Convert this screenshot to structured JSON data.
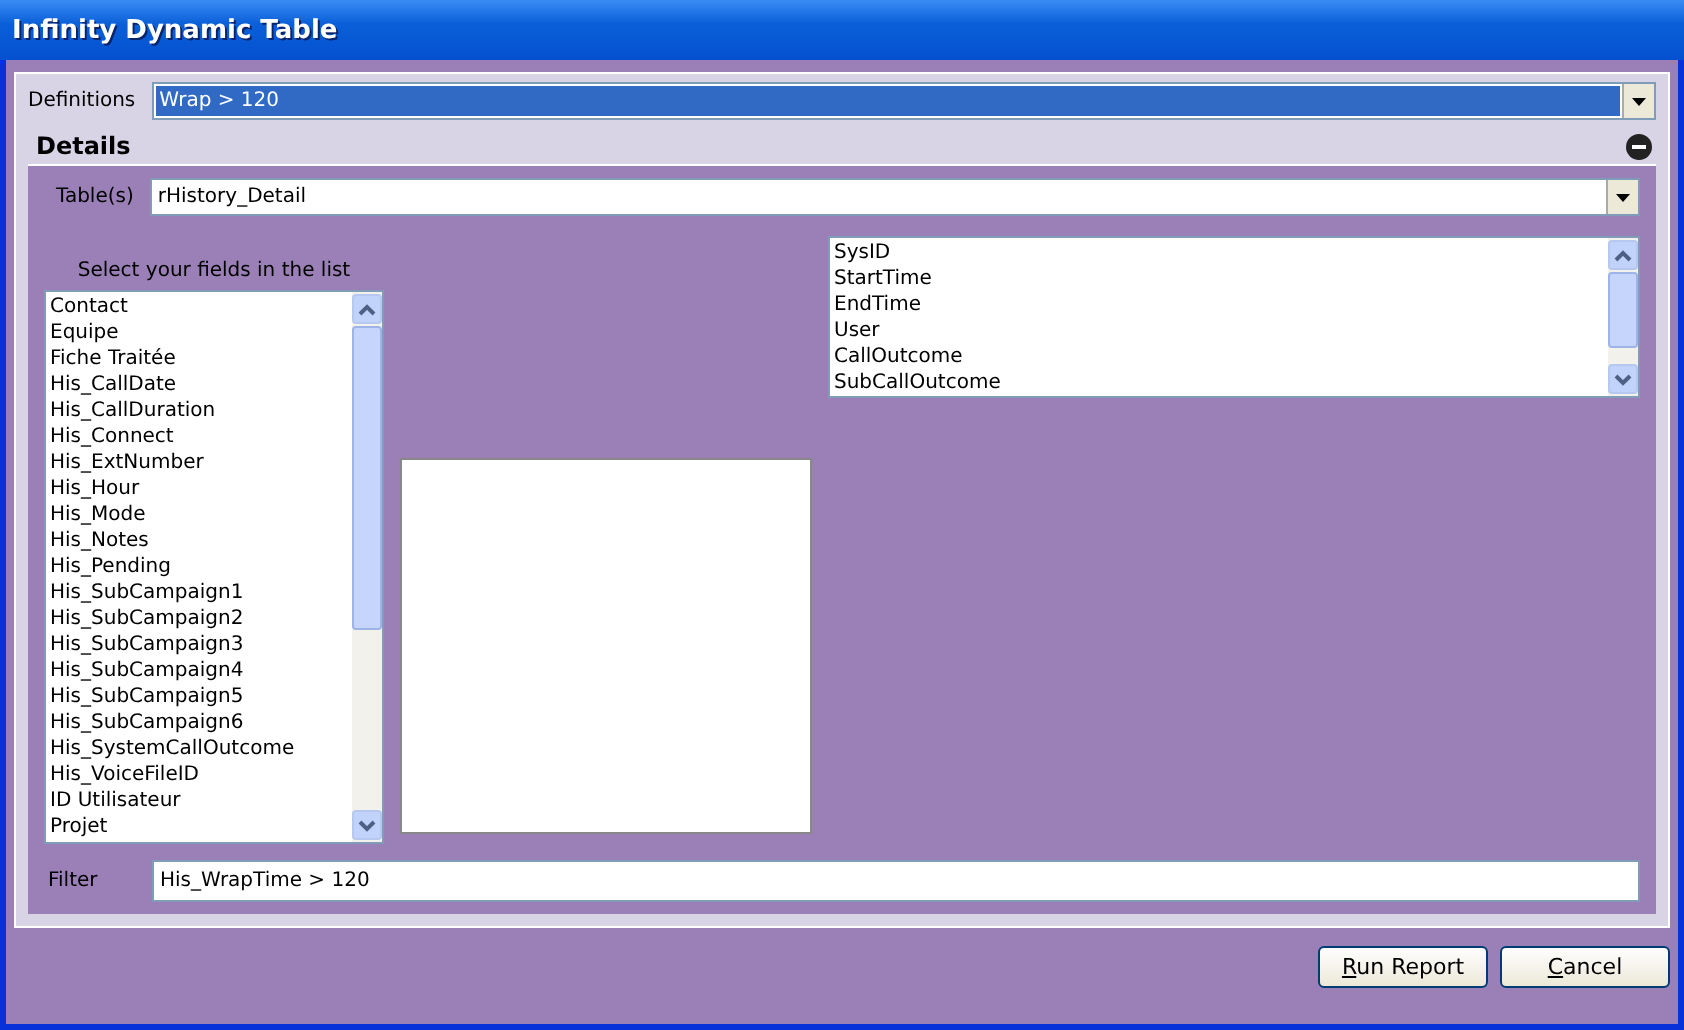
{
  "window": {
    "title": "Infinity Dynamic Table"
  },
  "definitions": {
    "label": "Definitions",
    "value": "Wrap > 120",
    "highlighted": true
  },
  "details": {
    "title": "Details",
    "expanded": true,
    "tables": {
      "label": "Table(s)",
      "value": "rHistory_Detail"
    },
    "fields_list": {
      "label": "Select your fields in the list",
      "items": [
        "Contact",
        "Equipe",
        "Fiche Traitée",
        "His_CallDate",
        "His_CallDuration",
        "His_Connect",
        "His_ExtNumber",
        "His_Hour",
        "His_Mode",
        "His_Notes",
        "His_Pending",
        "His_SubCampaign1",
        "His_SubCampaign2",
        "His_SubCampaign3",
        "His_SubCampaign4",
        "His_SubCampaign5",
        "His_SubCampaign6",
        "His_SystemCallOutcome",
        "His_VoiceFileID",
        "ID Utilisateur",
        "Projet"
      ]
    },
    "selected_list": {
      "items": [
        "SysID",
        "StartTime",
        "EndTime",
        "User",
        "CallOutcome",
        "SubCallOutcome"
      ]
    },
    "filter": {
      "label": "Filter",
      "value": "His_WrapTime > 120"
    }
  },
  "buttons": [
    "Run Report",
    "Cancel"
  ]
}
